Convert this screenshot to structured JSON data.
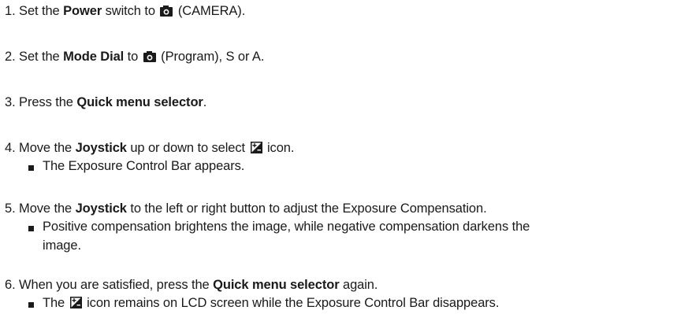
{
  "steps": [
    {
      "num": "1.",
      "pre": "Set the ",
      "bold": "Power",
      "post": " switch to ",
      "icon": "camera-icon",
      "after_icon": " (CAMERA)."
    },
    {
      "num": "2.",
      "pre": "Set the ",
      "bold": "Mode Dial",
      "post": " to ",
      "icon": "camera-icon",
      "after_icon": " (Program), S or A."
    },
    {
      "num": "3.",
      "pre": "Press the ",
      "bold": "Quick menu selector",
      "post": "."
    },
    {
      "num": "4.",
      "pre": "Move the ",
      "bold": "Joystick",
      "post": " up or down to select ",
      "icon": "exposure-compensation-icon",
      "after_icon": " icon.",
      "bullets": [
        "The Exposure Control Bar appears."
      ]
    },
    {
      "num": "5.",
      "pre": "Move the ",
      "bold": "Joystick",
      "post": " to the left or right button to adjust the Exposure Compensation.",
      "bullets": [
        "Positive compensation brightens the image, while negative compensation darkens the",
        "image."
      ]
    },
    {
      "num": "6.",
      "pre": "When you are satisfied, press the ",
      "bold": "Quick menu selector",
      "post": " again.",
      "bullets": [
        "The ",
        " icon remains on LCD screen while the Exposure Control Bar disappears."
      ]
    }
  ]
}
